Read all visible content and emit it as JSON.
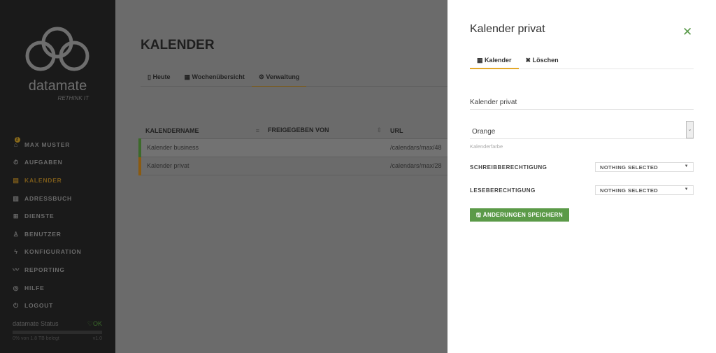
{
  "sidebar": {
    "brand": "datamate",
    "tagline": "RETHINK IT",
    "user_badge": "2",
    "items": [
      {
        "label": "MAX MUSTER",
        "icon": "home-icon"
      },
      {
        "label": "AUFGABEN",
        "icon": "stopwatch-icon"
      },
      {
        "label": "KALENDER",
        "icon": "calendar-icon"
      },
      {
        "label": "ADRESSBUCH",
        "icon": "book-icon"
      },
      {
        "label": "DIENSTE",
        "icon": "grid-icon"
      },
      {
        "label": "BENUTZER",
        "icon": "user-icon"
      },
      {
        "label": "KONFIGURATION",
        "icon": "bolt-icon"
      },
      {
        "label": "REPORTING",
        "icon": "chart-line-icon"
      },
      {
        "label": "HILFE",
        "icon": "lifebuoy-icon"
      },
      {
        "label": "LOGOUT",
        "icon": "power-icon"
      }
    ],
    "status": {
      "label": "datamate Status",
      "ok": "OK",
      "usage": "0% von 1.8 TB belegt",
      "usage_percent": 0,
      "version": "v1.0"
    }
  },
  "main": {
    "title": "KALENDER",
    "tabs": [
      "Heute",
      "Wochenübersicht",
      "Verwaltung"
    ],
    "table": {
      "headers": [
        "KALENDERNAME",
        "FREIGEGEBEN VON",
        "URL"
      ],
      "rows": [
        {
          "name": "Kalender business",
          "shared_by": "",
          "url": "/calendars/max/48",
          "color": "#3c6a2a"
        },
        {
          "name": "Kalender privat",
          "shared_by": "",
          "url": "/calendars/max/28",
          "color": "#8a5a10"
        }
      ]
    }
  },
  "panel": {
    "title": "Kalender privat",
    "tabs": [
      "Kalender",
      "Löschen"
    ],
    "name_value": "Kalender privat",
    "color_value": "Orange",
    "color_hint": "Kalenderfarbe",
    "write_label": "SCHREIBBERECHTIGUNG",
    "write_value": "NOTHING SELECTED",
    "read_label": "LESEBERECHTIGUNG",
    "read_value": "NOTHING SELECTED",
    "save_label": "ÄNDERUNGEN SPEICHERN"
  },
  "colors": {
    "accent": "#e3a82a",
    "success": "#5b9a48"
  }
}
